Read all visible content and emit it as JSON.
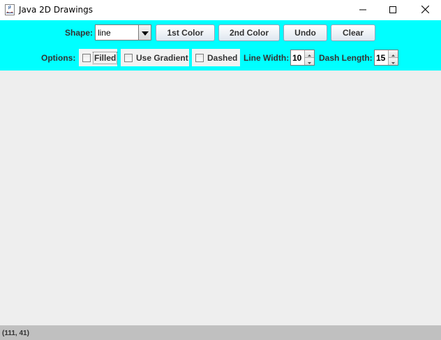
{
  "window": {
    "title": "Java 2D Drawings",
    "icon": "java-coffee-icon",
    "controls": [
      "minimize-icon",
      "maximize-icon",
      "close-icon"
    ]
  },
  "toolbar": {
    "shape_label": "Shape:",
    "shape_selected": "line",
    "first_color_label": "1st Color",
    "second_color_label": "2nd Color",
    "undo_label": "Undo",
    "clear_label": "Clear",
    "options_label": "Options:",
    "filled_label": "Filled",
    "filled_checked": false,
    "gradient_label": "Use Gradient",
    "gradient_checked": false,
    "dashed_label": "Dashed",
    "dashed_checked": false,
    "line_width_label": "Line Width:",
    "line_width_value": "10",
    "dash_length_label": "Dash Length:",
    "dash_length_value": "15"
  },
  "status": {
    "coordinates": "(111, 41)"
  },
  "colors": {
    "toolbar_bg": "#00ffff",
    "canvas_bg": "#eeeeee",
    "status_bg": "#c0c0c0"
  }
}
